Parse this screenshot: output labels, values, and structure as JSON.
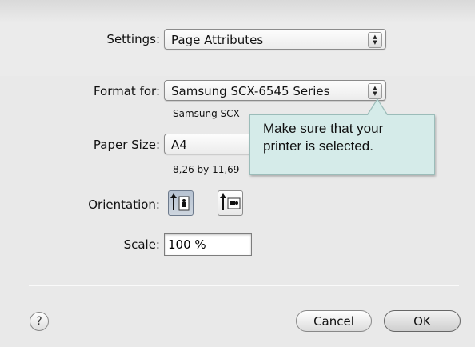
{
  "settings": {
    "label": "Settings:",
    "value": "Page Attributes"
  },
  "format_for": {
    "label": "Format for:",
    "value": "Samsung SCX-6545 Series",
    "subtext": "Samsung SCX"
  },
  "paper_size": {
    "label": "Paper Size:",
    "value": "A4",
    "dimensions": "8,26 by 11,69"
  },
  "orientation": {
    "label": "Orientation:",
    "options": [
      "portrait-icon",
      "landscape-icon"
    ],
    "selected": "portrait"
  },
  "scale": {
    "label": "Scale:",
    "value": "100 %"
  },
  "tooltip": {
    "line1": "Make sure that your",
    "line2": "printer is selected."
  },
  "buttons": {
    "help": "?",
    "cancel": "Cancel",
    "ok": "OK"
  },
  "colors": {
    "tooltip_bg": "#d5ebe9",
    "selected_button": "#b7c3d2"
  }
}
